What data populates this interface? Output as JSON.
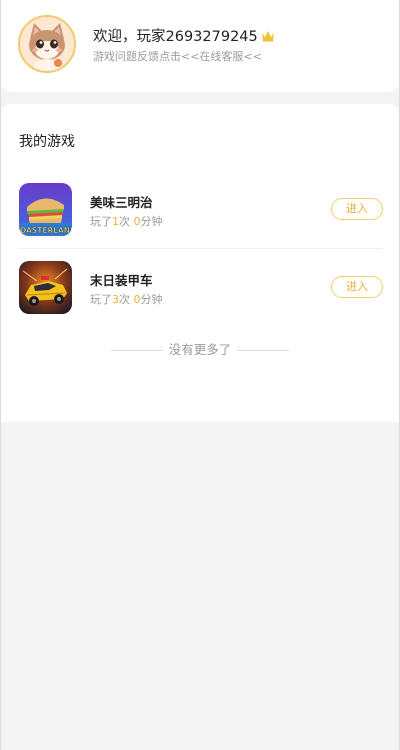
{
  "header": {
    "welcome_text": "欢迎，玩家2693279245",
    "feedback_text": "游戏问题反馈点击<<在线客服<<"
  },
  "my_games": {
    "title": "我的游戏",
    "games": [
      {
        "name": "美味三明治",
        "icon_text": "TOASTERLAND",
        "stats_prefix": "玩了",
        "play_count": "1",
        "count_unit": "次",
        "minutes": "0",
        "minutes_unit": "分钟",
        "enter_label": "进入"
      },
      {
        "name": "末日装甲车",
        "stats_prefix": "玩了",
        "play_count": "3",
        "count_unit": "次",
        "minutes": "0",
        "minutes_unit": "分钟",
        "enter_label": "进入"
      }
    ],
    "no_more_text": "没有更多了"
  },
  "colors": {
    "accent": "#f2b33b",
    "button_border": "#f5cd6a",
    "avatar_border": "#f5c96a",
    "page_bg": "#f4f4f4"
  },
  "icons": [
    "cat-avatar",
    "crown-icon",
    "sandwich-game-icon",
    "race-car-game-icon"
  ]
}
